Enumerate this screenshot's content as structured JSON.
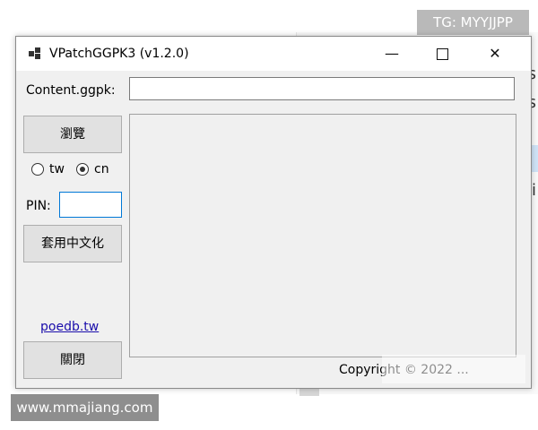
{
  "background_window": {
    "line1": "vs",
    "line2": "vs",
    "line3": "ti"
  },
  "watermarks": {
    "top_right": "TG: MYYJJPP",
    "bottom_left": "www.mmajiang.com"
  },
  "window": {
    "title": "VPatchGGPK3 (v1.2.0)",
    "minimize_glyph": "—",
    "close_glyph": "✕"
  },
  "form": {
    "content_label": "Content.ggpk:",
    "content_value": "",
    "browse_button": "瀏覽",
    "radio_tw_label": "tw",
    "radio_cn_label": "cn",
    "radio_selected": "cn",
    "pin_label": "PIN:",
    "pin_value": "",
    "apply_button": "套用中文化",
    "link_text": "poedb.tw",
    "close_button": "關閉",
    "log_text": "",
    "copyright": "Copyright © 2022 ..."
  }
}
